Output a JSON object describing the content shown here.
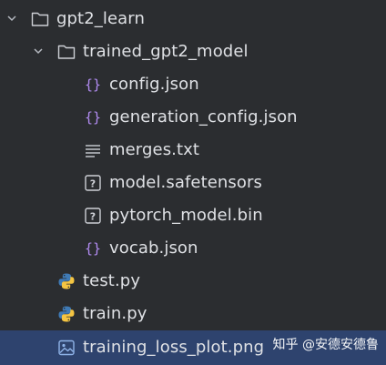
{
  "tree": {
    "root": {
      "label": "gpt2_learn",
      "icon": "folder-icon",
      "expanded": true
    },
    "model_folder": {
      "label": "trained_gpt2_model",
      "icon": "folder-icon",
      "expanded": true
    },
    "files": [
      {
        "label": "config.json",
        "icon": "json-braces-icon"
      },
      {
        "label": "generation_config.json",
        "icon": "json-braces-icon"
      },
      {
        "label": "merges.txt",
        "icon": "text-lines-icon"
      },
      {
        "label": "model.safetensors",
        "icon": "unknown-file-icon"
      },
      {
        "label": "pytorch_model.bin",
        "icon": "unknown-file-icon"
      },
      {
        "label": "vocab.json",
        "icon": "json-braces-icon"
      }
    ],
    "root_files": [
      {
        "label": "test.py",
        "icon": "python-icon"
      },
      {
        "label": "train.py",
        "icon": "python-icon"
      },
      {
        "label": "training_loss_plot.png",
        "icon": "image-file-icon",
        "selected": true
      }
    ]
  },
  "watermark": "知乎 @安德安德鲁",
  "colors": {
    "background": "#2b2d30",
    "selected_row": "#2e436e",
    "text": "#dfe1e5",
    "json_icon": "#b28cf2",
    "python_blue": "#3f7ab5",
    "python_yellow": "#f5c542"
  }
}
